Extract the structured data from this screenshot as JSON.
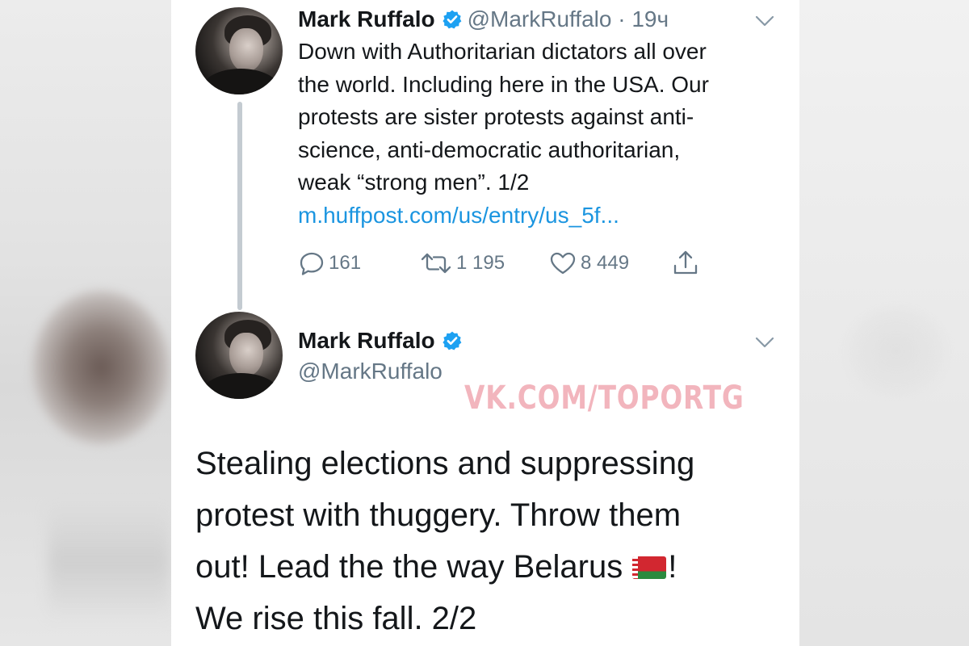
{
  "tweet1": {
    "author_name": "Mark Ruffalo",
    "handle": "@MarkRuffalo",
    "time_separator": " · ",
    "time": "19ч",
    "text_lines": [
      "Down with Authoritarian dictators all over",
      "the world. Including here in the USA. Our",
      "protests are sister protests against anti-",
      "science, anti-democratic authoritarian,",
      "weak “strong men”. 1/2"
    ],
    "link": "m.huffpost.com/us/entry/us_5f...",
    "replies": "161",
    "retweets": "1 195",
    "likes": "8 449"
  },
  "tweet2": {
    "author_name": "Mark Ruffalo",
    "handle": "@MarkRuffalo",
    "text_lines": [
      "Stealing elections and suppressing",
      "protest with thuggery. Throw them",
      "out! Lead the the way Belarus",
      "We rise this fall. 2/2"
    ],
    "after_flag": "!"
  },
  "watermark": "VK.COM/TOPORTG",
  "colors": {
    "verified_blue": "#1da1f2",
    "link_blue": "#1b95e0",
    "secondary_gray": "#657786",
    "watermark_pink": "#f2b5bd"
  },
  "icons": {
    "reply": "reply-icon",
    "retweet": "retweet-icon",
    "like": "heart-icon",
    "share": "share-icon",
    "verified": "verified-badge-icon",
    "menu": "chevron-down-icon",
    "flag": "belarus-flag-icon"
  }
}
